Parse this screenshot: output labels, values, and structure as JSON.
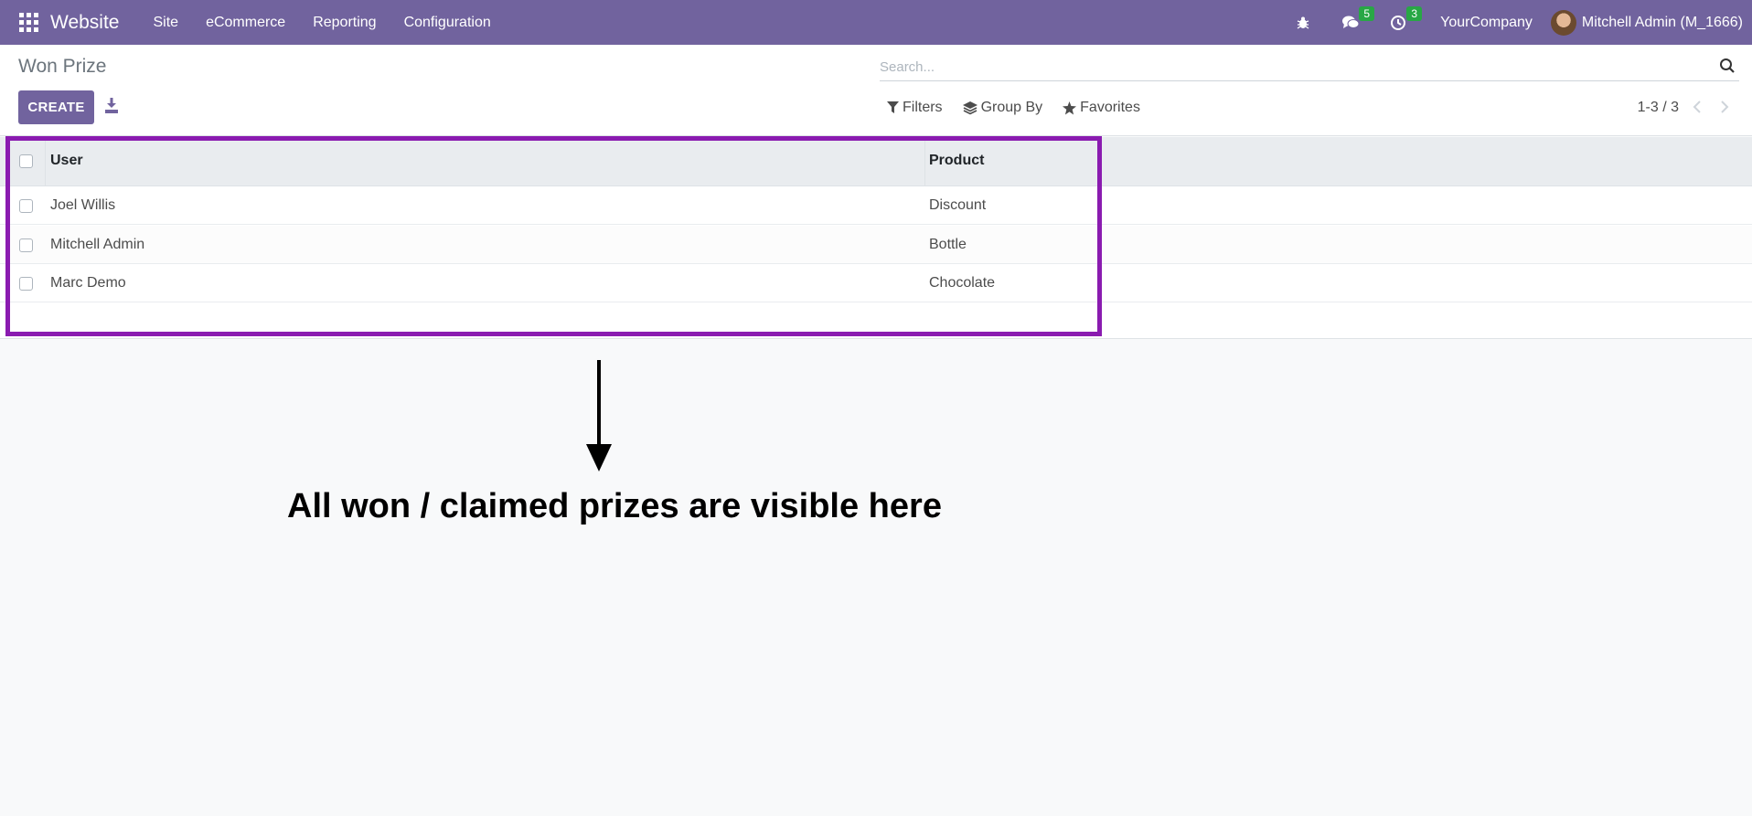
{
  "navbar": {
    "brand": "Website",
    "menu": [
      "Site",
      "eCommerce",
      "Reporting",
      "Configuration"
    ],
    "messages_count": "5",
    "activities_count": "3",
    "company": "YourCompany",
    "user": "Mitchell Admin (M_1666)"
  },
  "control_panel": {
    "title": "Won Prize",
    "create_label": "CREATE",
    "search_placeholder": "Search...",
    "filters_label": "Filters",
    "groupby_label": "Group By",
    "favorites_label": "Favorites",
    "pager": "1-3 / 3"
  },
  "table": {
    "columns": [
      "User",
      "Product"
    ],
    "rows": [
      {
        "user": "Joel Willis",
        "product": "Discount"
      },
      {
        "user": "Mitchell Admin",
        "product": "Bottle"
      },
      {
        "user": "Marc Demo",
        "product": "Chocolate"
      }
    ]
  },
  "annotation": "All won / claimed prizes are visible here",
  "colors": {
    "brand": "#71639e",
    "highlight": "#8a1bb0"
  }
}
